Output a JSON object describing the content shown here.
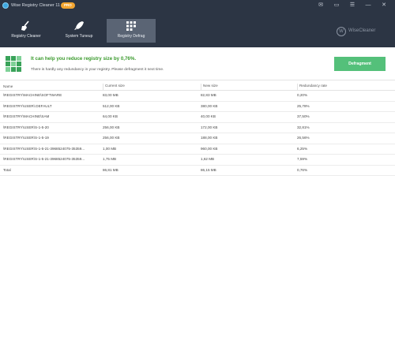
{
  "titlebar": {
    "title": "Wise Registry Cleaner 11",
    "badge": "PRO",
    "controls": [
      "✉",
      "▭",
      "☰",
      "—",
      "✕"
    ]
  },
  "nav": {
    "tabs": [
      {
        "label": "Registry Cleaner",
        "icon": "broom-icon"
      },
      {
        "label": "System Tuneup",
        "icon": "rocket-icon"
      },
      {
        "label": "Registry Defrag",
        "icon": "grid-icon",
        "active": true
      }
    ],
    "brand": "WiseCleaner",
    "brand_logo": "W"
  },
  "summary": {
    "headline": "It can help you reduce registry size by 0,76%.",
    "subline": "There is hardly any redundancy in your registry. Please defragment it next time.",
    "button": "Defragment"
  },
  "table": {
    "columns": [
      "Name",
      "Current size",
      "New size",
      "Redundancy rate"
    ],
    "rows": [
      [
        "\\REGISTRY\\MACHINE\\SOFTWARE",
        "83,00 MB",
        "82,83 MB",
        "0,20%"
      ],
      [
        "\\REGISTRY\\USER\\.DEFAULT",
        "512,00 KB",
        "380,00 KB",
        "25,78%"
      ],
      [
        "\\REGISTRY\\MACHINE\\SAM",
        "64,00 KB",
        "40,00 KB",
        "37,50%"
      ],
      [
        "\\REGISTRY\\USER\\S-1-5-20",
        "256,00 KB",
        "172,00 KB",
        "32,81%"
      ],
      [
        "\\REGISTRY\\USER\\S-1-5-19",
        "256,00 KB",
        "188,00 KB",
        "26,56%"
      ],
      [
        "\\REGISTRY\\USER\\S-1-5-21-3968524075-35359...",
        "1,00 MB",
        "960,00 KB",
        "6,25%"
      ],
      [
        "\\REGISTRY\\USER\\S-1-5-21-3968524075-35359...",
        "1,75 MB",
        "1,62 MB",
        "7,59%"
      ],
      [
        "Total",
        "86,81 MB",
        "86,15 MB",
        "0,76%"
      ]
    ]
  },
  "colors": {
    "header_bg": "#2c3544",
    "active_tab": "#5a6474",
    "accent_green": "#3a9a2c",
    "button_green": "#54c07a",
    "badge_orange": "#f2a531"
  }
}
